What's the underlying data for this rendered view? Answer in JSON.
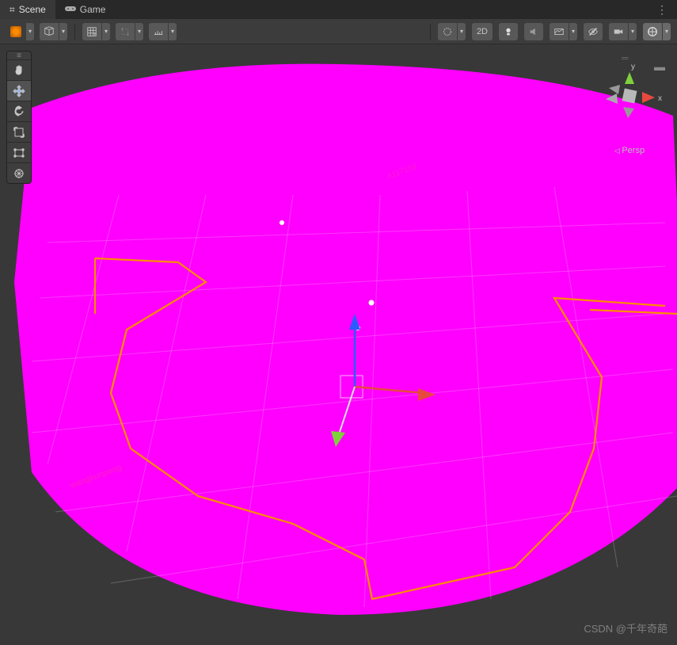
{
  "tabs": {
    "scene": "Scene",
    "game": "Game"
  },
  "toolbar": {
    "btn_2d": "2D"
  },
  "viewport": {
    "persp_label": "Persp",
    "axis_x": "x",
    "axis_y": "y"
  },
  "watermark": "CSDN @千年奇葩",
  "colors": {
    "magenta": "#ff00ff",
    "orange": "#ff8c00",
    "bg": "#383838",
    "axis_x": "#e8493f",
    "axis_y": "#7fd13b",
    "axis_z": "#3b7dd8",
    "gizmo_up": "#24e24a",
    "gizmo_fwd": "#2b5bff"
  }
}
